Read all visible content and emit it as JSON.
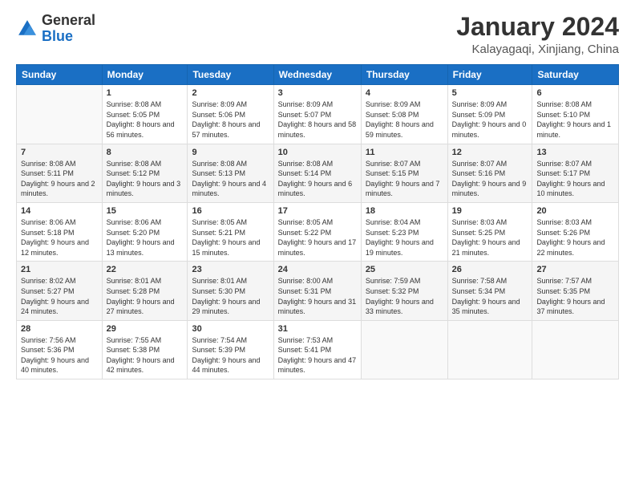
{
  "header": {
    "logo_general": "General",
    "logo_blue": "Blue",
    "title": "January 2024",
    "location": "Kalayagaqi, Xinjiang, China"
  },
  "days_of_week": [
    "Sunday",
    "Monday",
    "Tuesday",
    "Wednesday",
    "Thursday",
    "Friday",
    "Saturday"
  ],
  "weeks": [
    [
      {
        "day": "",
        "sunrise": "",
        "sunset": "",
        "daylight": ""
      },
      {
        "day": "1",
        "sunrise": "Sunrise: 8:08 AM",
        "sunset": "Sunset: 5:05 PM",
        "daylight": "Daylight: 8 hours and 56 minutes."
      },
      {
        "day": "2",
        "sunrise": "Sunrise: 8:09 AM",
        "sunset": "Sunset: 5:06 PM",
        "daylight": "Daylight: 8 hours and 57 minutes."
      },
      {
        "day": "3",
        "sunrise": "Sunrise: 8:09 AM",
        "sunset": "Sunset: 5:07 PM",
        "daylight": "Daylight: 8 hours and 58 minutes."
      },
      {
        "day": "4",
        "sunrise": "Sunrise: 8:09 AM",
        "sunset": "Sunset: 5:08 PM",
        "daylight": "Daylight: 8 hours and 59 minutes."
      },
      {
        "day": "5",
        "sunrise": "Sunrise: 8:09 AM",
        "sunset": "Sunset: 5:09 PM",
        "daylight": "Daylight: 9 hours and 0 minutes."
      },
      {
        "day": "6",
        "sunrise": "Sunrise: 8:08 AM",
        "sunset": "Sunset: 5:10 PM",
        "daylight": "Daylight: 9 hours and 1 minute."
      }
    ],
    [
      {
        "day": "7",
        "sunrise": "Sunrise: 8:08 AM",
        "sunset": "Sunset: 5:11 PM",
        "daylight": "Daylight: 9 hours and 2 minutes."
      },
      {
        "day": "8",
        "sunrise": "Sunrise: 8:08 AM",
        "sunset": "Sunset: 5:12 PM",
        "daylight": "Daylight: 9 hours and 3 minutes."
      },
      {
        "day": "9",
        "sunrise": "Sunrise: 8:08 AM",
        "sunset": "Sunset: 5:13 PM",
        "daylight": "Daylight: 9 hours and 4 minutes."
      },
      {
        "day": "10",
        "sunrise": "Sunrise: 8:08 AM",
        "sunset": "Sunset: 5:14 PM",
        "daylight": "Daylight: 9 hours and 6 minutes."
      },
      {
        "day": "11",
        "sunrise": "Sunrise: 8:07 AM",
        "sunset": "Sunset: 5:15 PM",
        "daylight": "Daylight: 9 hours and 7 minutes."
      },
      {
        "day": "12",
        "sunrise": "Sunrise: 8:07 AM",
        "sunset": "Sunset: 5:16 PM",
        "daylight": "Daylight: 9 hours and 9 minutes."
      },
      {
        "day": "13",
        "sunrise": "Sunrise: 8:07 AM",
        "sunset": "Sunset: 5:17 PM",
        "daylight": "Daylight: 9 hours and 10 minutes."
      }
    ],
    [
      {
        "day": "14",
        "sunrise": "Sunrise: 8:06 AM",
        "sunset": "Sunset: 5:18 PM",
        "daylight": "Daylight: 9 hours and 12 minutes."
      },
      {
        "day": "15",
        "sunrise": "Sunrise: 8:06 AM",
        "sunset": "Sunset: 5:20 PM",
        "daylight": "Daylight: 9 hours and 13 minutes."
      },
      {
        "day": "16",
        "sunrise": "Sunrise: 8:05 AM",
        "sunset": "Sunset: 5:21 PM",
        "daylight": "Daylight: 9 hours and 15 minutes."
      },
      {
        "day": "17",
        "sunrise": "Sunrise: 8:05 AM",
        "sunset": "Sunset: 5:22 PM",
        "daylight": "Daylight: 9 hours and 17 minutes."
      },
      {
        "day": "18",
        "sunrise": "Sunrise: 8:04 AM",
        "sunset": "Sunset: 5:23 PM",
        "daylight": "Daylight: 9 hours and 19 minutes."
      },
      {
        "day": "19",
        "sunrise": "Sunrise: 8:03 AM",
        "sunset": "Sunset: 5:25 PM",
        "daylight": "Daylight: 9 hours and 21 minutes."
      },
      {
        "day": "20",
        "sunrise": "Sunrise: 8:03 AM",
        "sunset": "Sunset: 5:26 PM",
        "daylight": "Daylight: 9 hours and 22 minutes."
      }
    ],
    [
      {
        "day": "21",
        "sunrise": "Sunrise: 8:02 AM",
        "sunset": "Sunset: 5:27 PM",
        "daylight": "Daylight: 9 hours and 24 minutes."
      },
      {
        "day": "22",
        "sunrise": "Sunrise: 8:01 AM",
        "sunset": "Sunset: 5:28 PM",
        "daylight": "Daylight: 9 hours and 27 minutes."
      },
      {
        "day": "23",
        "sunrise": "Sunrise: 8:01 AM",
        "sunset": "Sunset: 5:30 PM",
        "daylight": "Daylight: 9 hours and 29 minutes."
      },
      {
        "day": "24",
        "sunrise": "Sunrise: 8:00 AM",
        "sunset": "Sunset: 5:31 PM",
        "daylight": "Daylight: 9 hours and 31 minutes."
      },
      {
        "day": "25",
        "sunrise": "Sunrise: 7:59 AM",
        "sunset": "Sunset: 5:32 PM",
        "daylight": "Daylight: 9 hours and 33 minutes."
      },
      {
        "day": "26",
        "sunrise": "Sunrise: 7:58 AM",
        "sunset": "Sunset: 5:34 PM",
        "daylight": "Daylight: 9 hours and 35 minutes."
      },
      {
        "day": "27",
        "sunrise": "Sunrise: 7:57 AM",
        "sunset": "Sunset: 5:35 PM",
        "daylight": "Daylight: 9 hours and 37 minutes."
      }
    ],
    [
      {
        "day": "28",
        "sunrise": "Sunrise: 7:56 AM",
        "sunset": "Sunset: 5:36 PM",
        "daylight": "Daylight: 9 hours and 40 minutes."
      },
      {
        "day": "29",
        "sunrise": "Sunrise: 7:55 AM",
        "sunset": "Sunset: 5:38 PM",
        "daylight": "Daylight: 9 hours and 42 minutes."
      },
      {
        "day": "30",
        "sunrise": "Sunrise: 7:54 AM",
        "sunset": "Sunset: 5:39 PM",
        "daylight": "Daylight: 9 hours and 44 minutes."
      },
      {
        "day": "31",
        "sunrise": "Sunrise: 7:53 AM",
        "sunset": "Sunset: 5:41 PM",
        "daylight": "Daylight: 9 hours and 47 minutes."
      },
      {
        "day": "",
        "sunrise": "",
        "sunset": "",
        "daylight": ""
      },
      {
        "day": "",
        "sunrise": "",
        "sunset": "",
        "daylight": ""
      },
      {
        "day": "",
        "sunrise": "",
        "sunset": "",
        "daylight": ""
      }
    ]
  ]
}
